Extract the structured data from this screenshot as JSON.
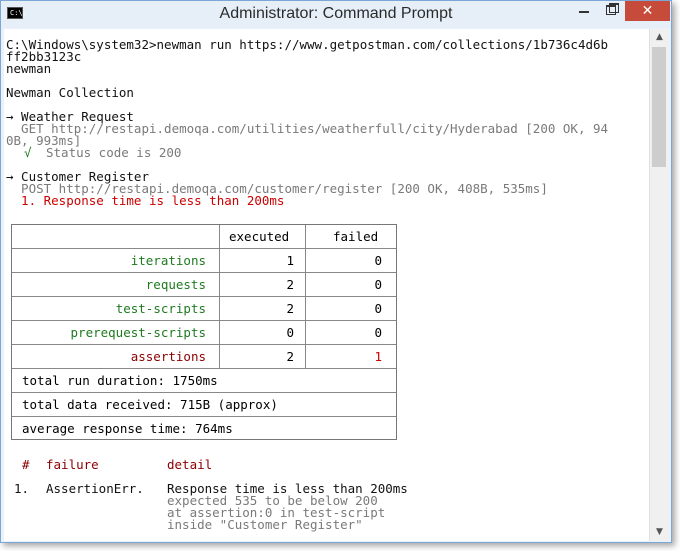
{
  "window": {
    "title": "Administrator: Command Prompt",
    "icon_label": "C:\\.",
    "close_label": "✕"
  },
  "console": {
    "command_line_1": "C:\\Windows\\system32>newman run https://www.getpostman.com/collections/1b736c4d6b",
    "command_line_2": "ff2bb3123c",
    "tool": "newman",
    "collection": "Newman Collection",
    "req1_name": "→ Weather Request",
    "req1_get_1": "  GET http://restapi.demoqa.com/utilities/weatherfull/city/Hyderabad [200 OK, 94",
    "req1_get_2": "0B, 993ms]",
    "req1_check_mark": "√",
    "req1_check_text": "Status code is 200",
    "req2_name": "→ Customer Register",
    "req2_post": "  POST http://restapi.demoqa.com/customer/register [200 OK, 408B, 535ms]",
    "req2_fail": "  1. Response time is less than 200ms"
  },
  "summary": {
    "headers": {
      "executed": "executed",
      "failed": "failed"
    },
    "rows": [
      {
        "label": "iterations",
        "executed": "1",
        "failed": "0"
      },
      {
        "label": "requests",
        "executed": "2",
        "failed": "0"
      },
      {
        "label": "test-scripts",
        "executed": "2",
        "failed": "0"
      },
      {
        "label": "prerequest-scripts",
        "executed": "0",
        "failed": "0"
      },
      {
        "label": "assertions",
        "executed": "2",
        "failed": "1"
      }
    ],
    "duration": "total run duration: 1750ms",
    "data_received": "total data received: 715B (approx)",
    "avg_response": "average response time: 764ms"
  },
  "failures": {
    "header_num": "#",
    "header_failure": "failure",
    "header_detail": "detail",
    "items": [
      {
        "num": "1.",
        "failure": "AssertionErr.",
        "detail": "Response time is less than 200ms",
        "sub1": "expected 535 to be below 200",
        "sub2": "at assertion:0 in test-script",
        "sub3": "inside \"Customer Register\""
      }
    ]
  },
  "colors": {
    "label_green": "#1f7a1f",
    "label_red": "#8b0000",
    "error_red": "#cc0000",
    "muted": "#7a7a7a",
    "close_button": "#c74b3a"
  }
}
